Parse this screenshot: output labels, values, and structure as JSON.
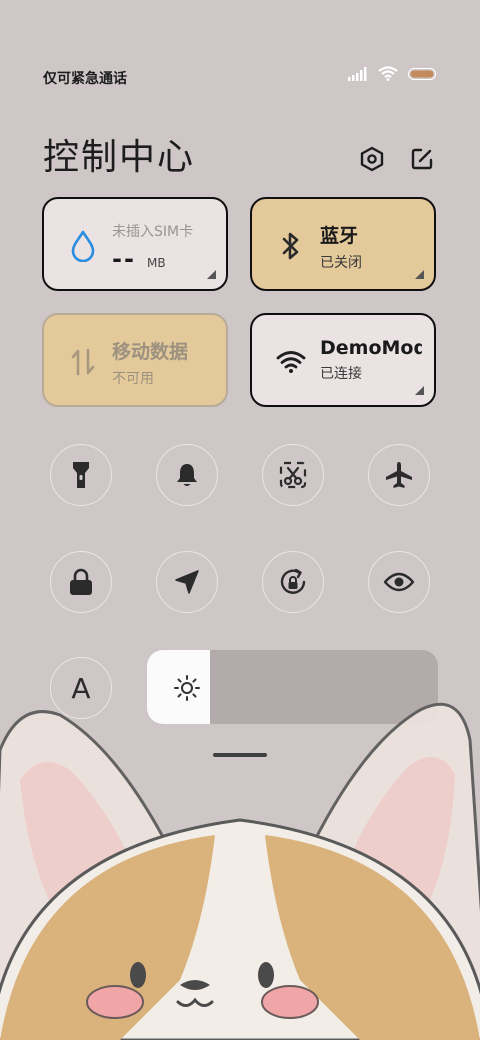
{
  "status_bar": {
    "carrier_text": "仅可紧急通话",
    "signal_icon": "signal-bars-icon",
    "wifi_icon": "wifi-icon",
    "battery_icon": "battery-icon"
  },
  "header": {
    "title": "控制中心",
    "settings_icon": "settings-hex-icon",
    "edit_icon": "edit-icon"
  },
  "tiles": [
    {
      "name": "sim-card",
      "title": "未插入SIM卡",
      "value": "--",
      "unit": "MB",
      "icon": "water-drop-icon",
      "color": "#ebe3e3"
    },
    {
      "name": "bluetooth",
      "title": "蓝牙",
      "subtitle": "已关闭",
      "icon": "bluetooth-icon",
      "color": "#e4c99b"
    },
    {
      "name": "mobile-data",
      "title": "移动数据",
      "subtitle": "不可用",
      "icon": "data-arrows-icon",
      "color": "#e4c99b"
    },
    {
      "name": "wifi",
      "title": "DemoMod",
      "subtitle": "已连接",
      "icon": "wifi-icon",
      "color": "#ebe3e3"
    }
  ],
  "toggles": [
    {
      "name": "flashlight",
      "icon": "flashlight-icon"
    },
    {
      "name": "silent",
      "icon": "bell-icon"
    },
    {
      "name": "screenshot",
      "icon": "scissors-icon"
    },
    {
      "name": "airplane",
      "icon": "airplane-icon"
    },
    {
      "name": "lock",
      "icon": "lock-icon"
    },
    {
      "name": "location",
      "icon": "location-arrow-icon"
    },
    {
      "name": "rotation",
      "icon": "rotation-lock-icon"
    },
    {
      "name": "eye-care",
      "icon": "eye-icon"
    },
    {
      "name": "font",
      "icon": "font-a-icon",
      "label": "A"
    }
  ],
  "brightness": {
    "level": 0.215,
    "icon": "sun-icon"
  },
  "colors": {
    "gold_tile": "#e4c99b",
    "light_tile": "#ebe3e3",
    "background": "#cfc7c7"
  }
}
